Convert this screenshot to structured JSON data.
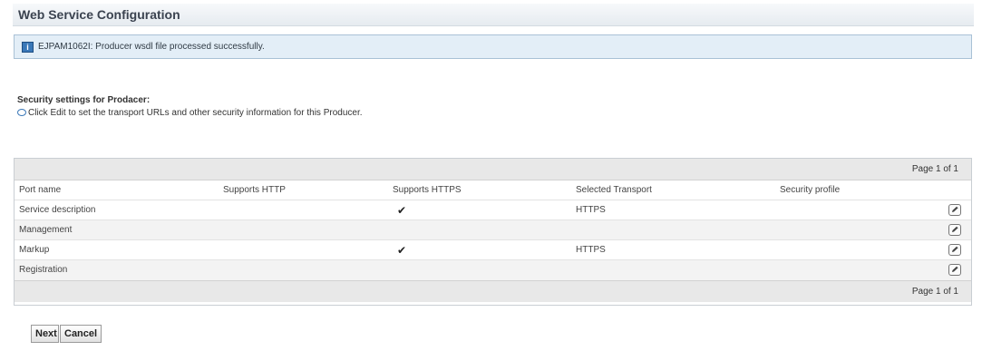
{
  "header": {
    "title": "Web Service Configuration"
  },
  "message": {
    "text": "EJPAM1062I: Producer wsdl file processed successfully.",
    "icon": "info-icon"
  },
  "security": {
    "title": "Security settings for Prodacer:",
    "help_text": "Click Edit to set the transport URLs and other security information for this Producer.",
    "help_icon": "help-bubble-icon"
  },
  "table": {
    "pager_top": "Page 1 of 1",
    "pager_bottom": "Page 1 of 1",
    "columns": [
      "Port name",
      "Supports HTTP",
      "Supports HTTPS",
      "Selected Transport",
      "Security profile"
    ],
    "rows": [
      {
        "port_name": "Service description",
        "supports_http": "",
        "supports_https": "✔",
        "selected_transport": "HTTPS",
        "security_profile": ""
      },
      {
        "port_name": "Management",
        "supports_http": "",
        "supports_https": "",
        "selected_transport": "",
        "security_profile": ""
      },
      {
        "port_name": "Markup",
        "supports_http": "",
        "supports_https": "✔",
        "selected_transport": "HTTPS",
        "security_profile": ""
      },
      {
        "port_name": "Registration",
        "supports_http": "",
        "supports_https": "",
        "selected_transport": "",
        "security_profile": ""
      }
    ],
    "edit_icon": "edit-pencil-icon"
  },
  "buttons": {
    "next": "Next",
    "cancel": "Cancel"
  },
  "colors": {
    "message_bg": "#e3eef7",
    "message_border": "#a9c1d6",
    "pager_bg": "#e8e8e8",
    "accent": "#3a78b8"
  }
}
